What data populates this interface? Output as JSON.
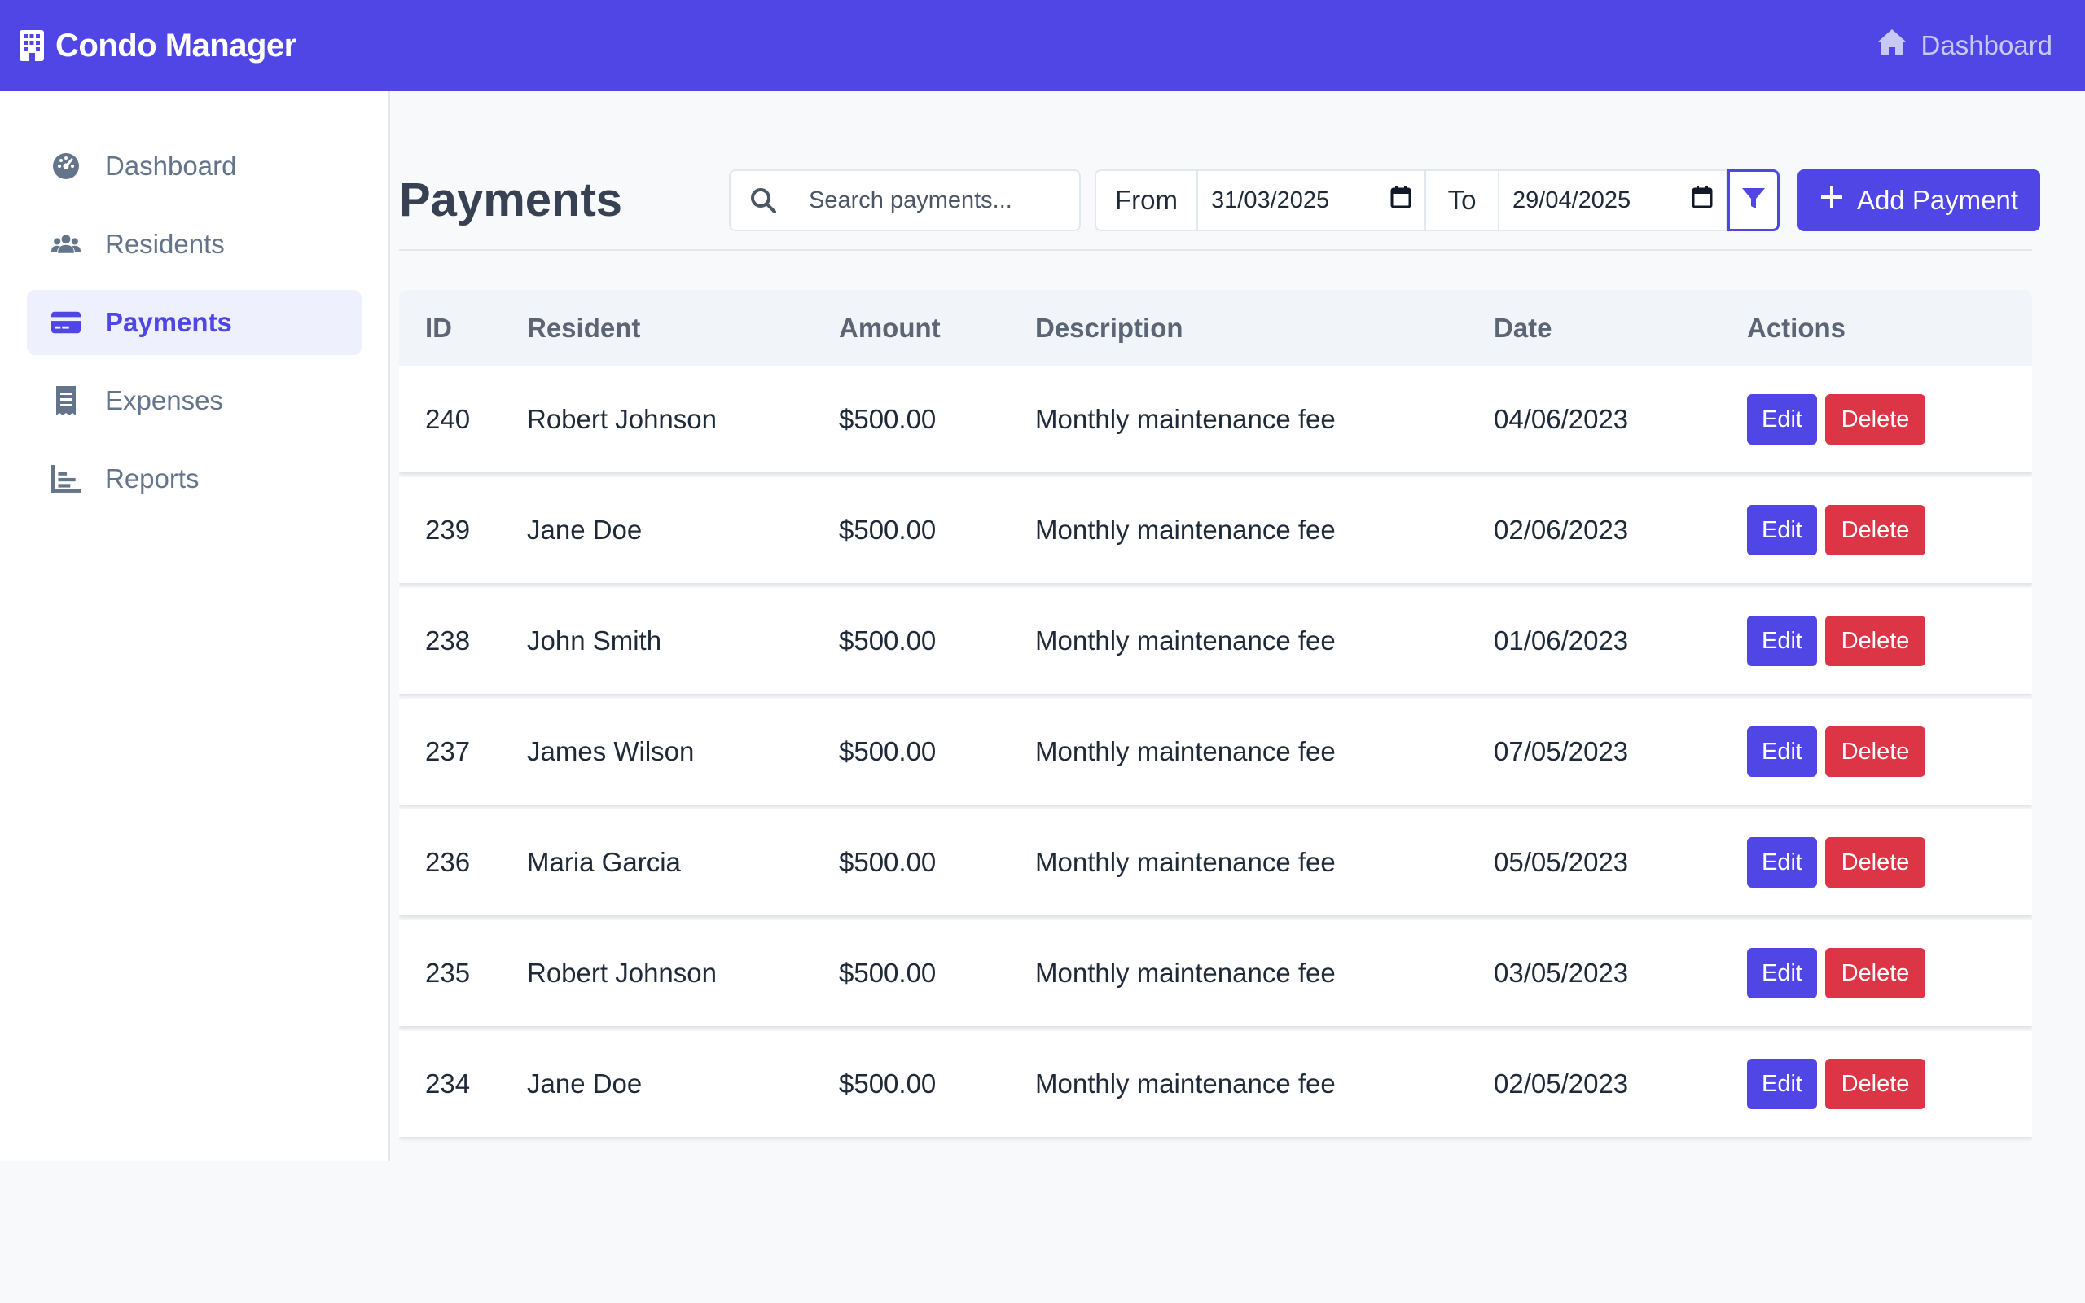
{
  "app": {
    "name": "Condo Manager",
    "brand_icon": "building-icon",
    "top_link": {
      "label": "Dashboard",
      "icon": "home-icon"
    },
    "colors": {
      "primary": "#4f46e5",
      "danger": "#dc3545"
    }
  },
  "sidebar": {
    "items": [
      {
        "label": "Dashboard",
        "icon": "gauge-icon",
        "active": false
      },
      {
        "label": "Residents",
        "icon": "users-icon",
        "active": false
      },
      {
        "label": "Payments",
        "icon": "credit-card-icon",
        "active": true
      },
      {
        "label": "Expenses",
        "icon": "receipt-icon",
        "active": false
      },
      {
        "label": "Reports",
        "icon": "bar-chart-icon",
        "active": false
      }
    ]
  },
  "page": {
    "title": "Payments",
    "search_placeholder": "Search payments...",
    "filter": {
      "from_label": "From",
      "from_value": "31/03/2025",
      "to_label": "To",
      "to_value": "29/04/2025"
    },
    "add_button": "Add Payment"
  },
  "table": {
    "headers": [
      "ID",
      "Resident",
      "Amount",
      "Description",
      "Date",
      "Actions"
    ],
    "edit_label": "Edit",
    "delete_label": "Delete",
    "rows": [
      {
        "id": "240",
        "resident": "Robert Johnson",
        "amount": "$500.00",
        "description": "Monthly maintenance fee",
        "date": "04/06/2023"
      },
      {
        "id": "239",
        "resident": "Jane Doe",
        "amount": "$500.00",
        "description": "Monthly maintenance fee",
        "date": "02/06/2023"
      },
      {
        "id": "238",
        "resident": "John Smith",
        "amount": "$500.00",
        "description": "Monthly maintenance fee",
        "date": "01/06/2023"
      },
      {
        "id": "237",
        "resident": "James Wilson",
        "amount": "$500.00",
        "description": "Monthly maintenance fee",
        "date": "07/05/2023"
      },
      {
        "id": "236",
        "resident": "Maria Garcia",
        "amount": "$500.00",
        "description": "Monthly maintenance fee",
        "date": "05/05/2023"
      },
      {
        "id": "235",
        "resident": "Robert Johnson",
        "amount": "$500.00",
        "description": "Monthly maintenance fee",
        "date": "03/05/2023"
      },
      {
        "id": "234",
        "resident": "Jane Doe",
        "amount": "$500.00",
        "description": "Monthly maintenance fee",
        "date": "02/05/2023"
      }
    ]
  }
}
